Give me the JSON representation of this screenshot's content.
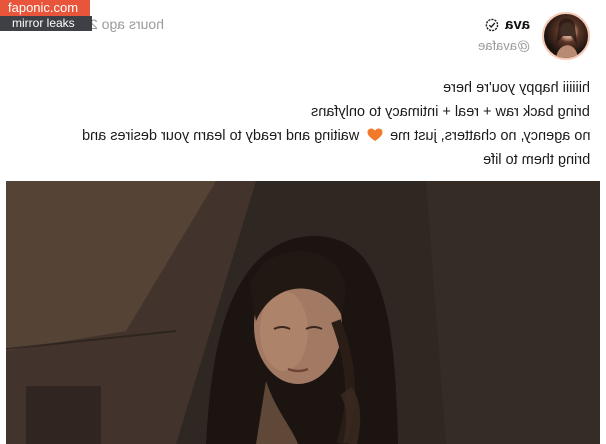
{
  "watermark": {
    "site": "faponic.com",
    "tag": "mirror leaks"
  },
  "post": {
    "timestamp": "2 hours ago",
    "display_name": "ava",
    "handle": "@avafae",
    "lines": [
      "hiiiiii happy you're here",
      "bring back raw + real + intimacy to onlyfans",
      "no agency, no chatters, just me",
      "waiting and ready to learn your desires and",
      "bring them to life"
    ]
  },
  "icons": {
    "verified": "verified-badge-icon",
    "heart": "orange-heart-icon",
    "avatar": "profile-photo"
  },
  "colors": {
    "watermark_site_bg": "#e8553a",
    "watermark_tag_bg": "#3e4046",
    "heart": "#f07a2a",
    "muted_text": "#9a9a9a"
  }
}
